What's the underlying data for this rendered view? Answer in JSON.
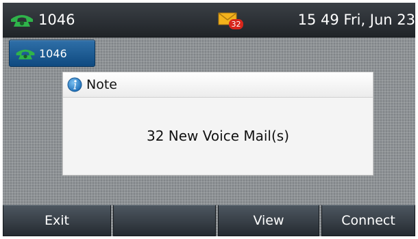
{
  "status_bar": {
    "account": "1046",
    "voicemail_count": "32",
    "datetime": "15 49 Fri, Jun 23"
  },
  "line_key": {
    "label": "1046"
  },
  "dialog": {
    "title": "Note",
    "message": "32 New Voice Mail(s)"
  },
  "softkeys": [
    "Exit",
    "",
    "View",
    "Connect"
  ],
  "colors": {
    "phone_green": "#2fb34a",
    "line_key_blue": "#1d5e97",
    "badge_red": "#d8261b",
    "envelope_yellow": "#f3b21c"
  },
  "icons": [
    "phone-icon",
    "voicemail-envelope-icon",
    "info-icon"
  ]
}
